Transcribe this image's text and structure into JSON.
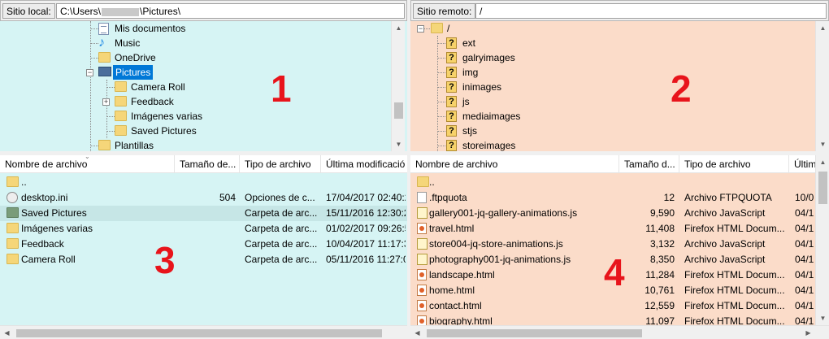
{
  "local": {
    "site_label": "Sitio local:",
    "path_prefix": "C:\\Users\\",
    "path_suffix": "\\Pictures\\",
    "tree": [
      {
        "label": "Mis documentos",
        "icon": "document-icon"
      },
      {
        "label": "Music",
        "icon": "music-note-icon"
      },
      {
        "label": "OneDrive",
        "icon": "folder-icon"
      },
      {
        "label": "Pictures",
        "icon": "pictures-folder-icon",
        "selected": true
      },
      {
        "label": "Camera Roll",
        "icon": "folder-icon"
      },
      {
        "label": "Feedback",
        "icon": "folder-icon"
      },
      {
        "label": "Imágenes varias",
        "icon": "folder-icon"
      },
      {
        "label": "Saved Pictures",
        "icon": "folder-icon"
      },
      {
        "label": "Plantillas",
        "icon": "folder-icon"
      }
    ],
    "columns": [
      "Nombre de archivo",
      "Tamaño de...",
      "Tipo de archivo",
      "Última modificació"
    ],
    "files": [
      {
        "name": "..",
        "size": "",
        "type": "",
        "modified": "",
        "icon": "folder-icon"
      },
      {
        "name": "desktop.ini",
        "size": "504",
        "type": "Opciones de c...",
        "modified": "17/04/2017 02:40:2",
        "icon": "settings-file-icon"
      },
      {
        "name": "Saved Pictures",
        "size": "",
        "type": "Carpeta de arc...",
        "modified": "15/11/2016 12:30:2",
        "icon": "folder-icon"
      },
      {
        "name": "Imágenes varias",
        "size": "",
        "type": "Carpeta de arc...",
        "modified": "01/02/2017 09:26:5",
        "icon": "folder-icon"
      },
      {
        "name": "Feedback",
        "size": "",
        "type": "Carpeta de arc...",
        "modified": "10/04/2017 11:17:3",
        "icon": "folder-icon"
      },
      {
        "name": "Camera Roll",
        "size": "",
        "type": "Carpeta de arc...",
        "modified": "05/11/2016 11:27:0",
        "icon": "folder-icon"
      }
    ],
    "tree_number": "1",
    "list_number": "3"
  },
  "remote": {
    "site_label": "Sitio remoto:",
    "path": "/",
    "tree": [
      {
        "label": "/",
        "icon": "folder-icon"
      },
      {
        "label": "ext",
        "icon": "unknown-folder-icon"
      },
      {
        "label": "galryimages",
        "icon": "unknown-folder-icon"
      },
      {
        "label": "img",
        "icon": "unknown-folder-icon"
      },
      {
        "label": "inimages",
        "icon": "unknown-folder-icon"
      },
      {
        "label": "js",
        "icon": "unknown-folder-icon"
      },
      {
        "label": "mediaimages",
        "icon": "unknown-folder-icon"
      },
      {
        "label": "stjs",
        "icon": "unknown-folder-icon"
      },
      {
        "label": "storeimages",
        "icon": "unknown-folder-icon"
      }
    ],
    "columns": [
      "Nombre de archivo",
      "Tamaño d...",
      "Tipo de archivo",
      "Últim"
    ],
    "files": [
      {
        "name": "..",
        "size": "",
        "type": "",
        "modified": "",
        "icon": "folder-icon"
      },
      {
        "name": ".ftpquota",
        "size": "12",
        "type": "Archivo FTPQUOTA",
        "modified": "10/0",
        "icon": "file-icon"
      },
      {
        "name": "gallery001-jq-gallery-animations.js",
        "size": "9,590",
        "type": "Archivo JavaScript",
        "modified": "04/1",
        "icon": "js-file-icon"
      },
      {
        "name": "travel.html",
        "size": "11,408",
        "type": "Firefox HTML Docum...",
        "modified": "04/1",
        "icon": "html-file-icon"
      },
      {
        "name": "store004-jq-store-animations.js",
        "size": "3,132",
        "type": "Archivo JavaScript",
        "modified": "04/1",
        "icon": "js-file-icon"
      },
      {
        "name": "photography001-jq-animations.js",
        "size": "8,350",
        "type": "Archivo JavaScript",
        "modified": "04/1",
        "icon": "js-file-icon"
      },
      {
        "name": "landscape.html",
        "size": "11,284",
        "type": "Firefox HTML Docum...",
        "modified": "04/1",
        "icon": "html-file-icon"
      },
      {
        "name": "home.html",
        "size": "10,761",
        "type": "Firefox HTML Docum...",
        "modified": "04/1",
        "icon": "html-file-icon"
      },
      {
        "name": "contact.html",
        "size": "12,559",
        "type": "Firefox HTML Docum...",
        "modified": "04/1",
        "icon": "html-file-icon"
      },
      {
        "name": "biography.html",
        "size": "11,097",
        "type": "Firefox HTML Docum...",
        "modified": "04/1",
        "icon": "html-file-icon"
      }
    ],
    "tree_number": "2",
    "list_number": "4"
  },
  "colors": {
    "local_bg": "#d6f4f4",
    "remote_bg": "#fbdcc9",
    "annotation_red": "#e8141b",
    "selection_blue": "#0078d7"
  }
}
